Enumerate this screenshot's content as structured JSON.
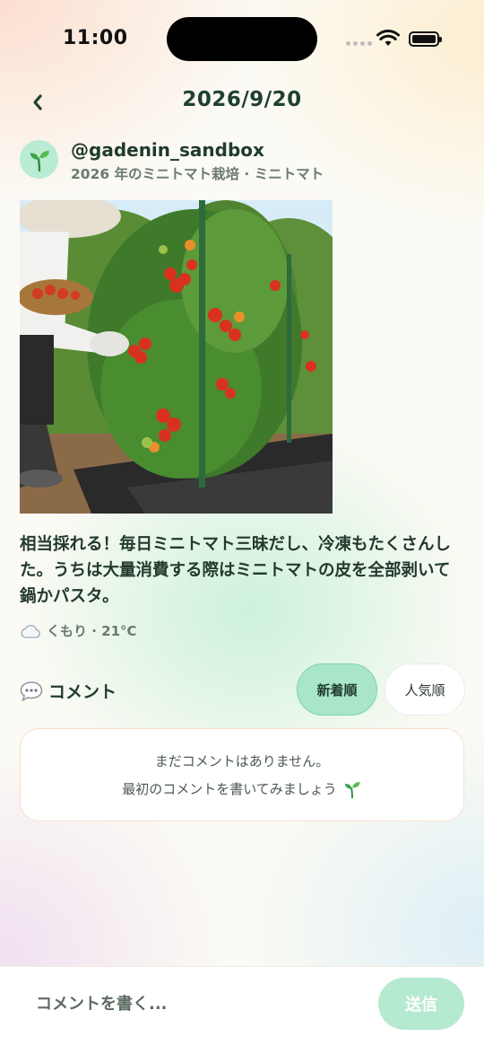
{
  "status_bar": {
    "time": "11:00"
  },
  "header": {
    "title": "2026/9/20"
  },
  "post": {
    "username": "@gadenin_sandbox",
    "subtitle": "2026 年のミニトマト栽培 · ミニトマト",
    "text": "相当採れる！毎日ミニトマト三昧だし、冷凍もたくさんした。うちは大量消費する際はミニトマトの皮を全部剥いて鍋かパスタ。",
    "weather": "くもり · 21°C",
    "weather_icon": "cloud-icon",
    "avatar_icon": "seedling-icon"
  },
  "comments": {
    "title": "コメント",
    "sort_new": "新着順",
    "sort_popular": "人気順",
    "empty_line1": "まだコメントはありません。",
    "empty_line2": "最初のコメントを書いてみましょう"
  },
  "composer": {
    "placeholder": "コメントを書く...",
    "send_label": "送信"
  },
  "colors": {
    "accent": "#a8e5c9",
    "title_text": "#1f4030",
    "send_button": "#b6ead0"
  }
}
